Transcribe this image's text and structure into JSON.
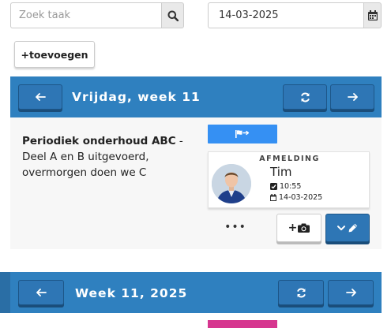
{
  "search": {
    "placeholder": "Zoek taak",
    "icon": "search-icon"
  },
  "date_picker": {
    "value": "14-03-2025",
    "icon": "calendar-icon"
  },
  "toolbar": {
    "add_label": "+toevoegen"
  },
  "day_section": {
    "prev_icon": "arrow-left-icon",
    "title": "Vrijdag, week 11",
    "refresh_icon": "refresh-icon",
    "next_icon": "arrow-right-icon",
    "task": {
      "title_bold": "Periodiek onderhoud ABC",
      "title_rest": " - Deel A en B uitgevoerd, overmorgen doen we C",
      "flag_icon": "flag-arrow-icon",
      "card": {
        "label": "AFMELDING",
        "person": "Tim",
        "time": "10:55",
        "date": "14-03-2025",
        "time_icon": "check-square-icon",
        "date_icon": "calendar-icon"
      },
      "more_label": "•••",
      "camera_label": "+",
      "camera_icon": "camera-icon",
      "edit_icons": [
        "chevron-down-icon",
        "pencil-icon"
      ]
    }
  },
  "week_section": {
    "prev_icon": "arrow-left-icon",
    "title": "Week 11, 2025",
    "refresh_icon": "refresh-icon",
    "next_icon": "arrow-right-icon"
  },
  "colors": {
    "header_blue": "#2f80bf",
    "button_blue": "#2e76b5",
    "flag_blue": "#3590f3",
    "badge_pink": "#d6368f"
  }
}
